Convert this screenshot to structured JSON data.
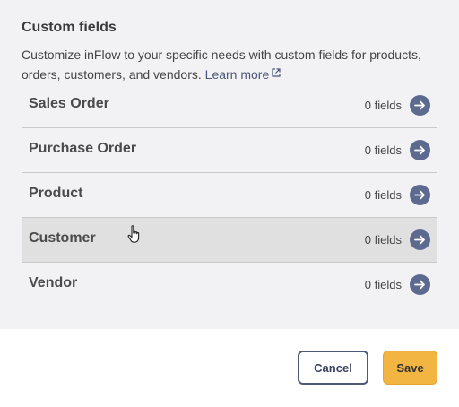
{
  "header": {
    "title": "Custom fields",
    "description": "Customize inFlow to your specific needs with custom fields for products, orders, customers, and vendors.",
    "learn_more": "Learn more"
  },
  "rows": [
    {
      "label": "Sales Order",
      "count": "0 fields"
    },
    {
      "label": "Purchase Order",
      "count": "0 fields"
    },
    {
      "label": "Product",
      "count": "0 fields"
    },
    {
      "label": "Customer",
      "count": "0 fields"
    },
    {
      "label": "Vendor",
      "count": "0 fields"
    }
  ],
  "footer": {
    "cancel_label": "Cancel",
    "save_label": "Save"
  },
  "colors": {
    "accent": "#5c6a8f",
    "save": "#f2b542",
    "hover_row": "#e0e0e0"
  }
}
